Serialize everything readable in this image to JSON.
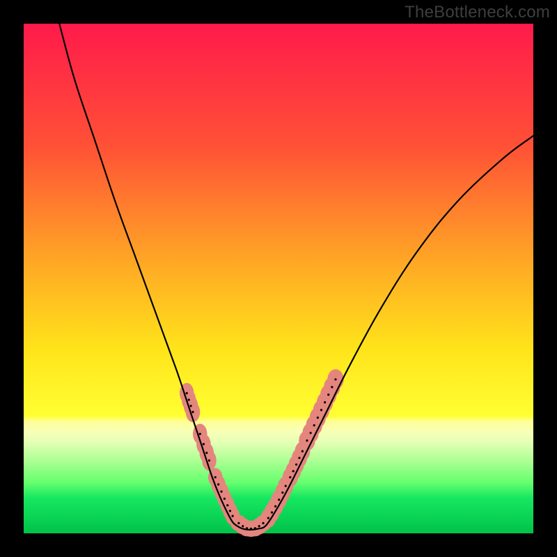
{
  "watermark": "TheBottleneck.com",
  "chart_data": {
    "type": "line",
    "title": "",
    "xlabel": "",
    "ylabel": "",
    "xlim": [
      0,
      100
    ],
    "ylim": [
      0,
      100
    ],
    "grid": false,
    "gradient_stops": [
      {
        "pos": 0,
        "color": "#ff1a4b"
      },
      {
        "pos": 24,
        "color": "#ff5136"
      },
      {
        "pos": 48,
        "color": "#ffac24"
      },
      {
        "pos": 64,
        "color": "#ffe41a"
      },
      {
        "pos": 77,
        "color": "#ffff33"
      },
      {
        "pos": 78,
        "color": "#ffff96"
      },
      {
        "pos": 80,
        "color": "#f8ffb8"
      },
      {
        "pos": 82,
        "color": "#e6ffb5"
      },
      {
        "pos": 85,
        "color": "#b8ff9a"
      },
      {
        "pos": 90,
        "color": "#66ff6e"
      },
      {
        "pos": 93,
        "color": "#17e860"
      },
      {
        "pos": 100,
        "color": "#00c24a"
      }
    ],
    "series": [
      {
        "name": "left-limb",
        "stroke": "#000000",
        "stroke_width": 2.2,
        "x": [
          7,
          10,
          14,
          18,
          22,
          26,
          30,
          32,
          34,
          35.5,
          37,
          38.5,
          40,
          41,
          41.8
        ],
        "y": [
          100,
          89,
          77,
          65,
          54,
          43,
          32,
          26,
          20,
          15.5,
          11,
          7.2,
          4,
          2.2,
          1.5
        ]
      },
      {
        "name": "valley-floor",
        "stroke": "#000000",
        "stroke_width": 2.2,
        "x": [
          41.8,
          43,
          44.5,
          46,
          47.5
        ],
        "y": [
          1.5,
          0.9,
          0.7,
          0.9,
          1.5
        ]
      },
      {
        "name": "right-limb",
        "stroke": "#000000",
        "stroke_width": 2.2,
        "x": [
          47.5,
          49.5,
          52,
          55,
          59,
          64,
          70,
          77,
          85,
          94,
          100
        ],
        "y": [
          1.5,
          4.5,
          9,
          15,
          23,
          33,
          44,
          55,
          65,
          73.5,
          78
        ]
      }
    ],
    "blob_clusters": [
      {
        "name": "left-upper",
        "color": "#e4857e",
        "points": [
          [
            32.0,
            27.5
          ],
          [
            32.4,
            26.2
          ],
          [
            32.8,
            25.0
          ],
          [
            33.2,
            23.8
          ]
        ],
        "rx": 1.4,
        "ry": 2.0
      },
      {
        "name": "left-mid",
        "color": "#e4857e",
        "points": [
          [
            34.6,
            19.5
          ],
          [
            35.3,
            17.5
          ],
          [
            35.9,
            15.8
          ],
          [
            36.4,
            14.3
          ]
        ],
        "rx": 1.4,
        "ry": 2.0
      },
      {
        "name": "left-lower",
        "color": "#e4857e",
        "points": [
          [
            37.6,
            11.0
          ],
          [
            38.2,
            9.6
          ],
          [
            38.8,
            8.2
          ],
          [
            39.4,
            6.8
          ],
          [
            40.0,
            5.5
          ],
          [
            40.5,
            4.4
          ],
          [
            41.0,
            3.4
          ]
        ],
        "rx": 1.4,
        "ry": 1.8
      },
      {
        "name": "valley",
        "color": "#e4857e",
        "points": [
          [
            42.2,
            2.0
          ],
          [
            43.0,
            1.4
          ],
          [
            43.8,
            1.0
          ],
          [
            44.6,
            0.9
          ],
          [
            45.4,
            1.0
          ],
          [
            46.2,
            1.4
          ],
          [
            47.0,
            2.0
          ]
        ],
        "rx": 1.6,
        "ry": 1.6
      },
      {
        "name": "right-lower",
        "color": "#e4857e",
        "points": [
          [
            48.0,
            3.0
          ],
          [
            48.7,
            4.1
          ],
          [
            49.4,
            5.3
          ],
          [
            50.1,
            6.6
          ],
          [
            50.8,
            8.0
          ],
          [
            51.4,
            9.3
          ]
        ],
        "rx": 1.5,
        "ry": 1.9
      },
      {
        "name": "right-mid",
        "color": "#e4857e",
        "points": [
          [
            52.3,
            11.0
          ],
          [
            52.9,
            12.2
          ],
          [
            53.5,
            13.5
          ],
          [
            54.1,
            14.8
          ],
          [
            54.7,
            16.1
          ]
        ],
        "rx": 1.5,
        "ry": 1.9
      },
      {
        "name": "right-upper",
        "color": "#e4857e",
        "points": [
          [
            55.6,
            18.2
          ],
          [
            56.3,
            19.7
          ],
          [
            57.0,
            21.2
          ],
          [
            57.7,
            22.7
          ],
          [
            58.4,
            24.2
          ],
          [
            59.1,
            25.7
          ],
          [
            59.8,
            27.2
          ],
          [
            60.5,
            28.7
          ],
          [
            61.2,
            30.2
          ]
        ],
        "rx": 1.6,
        "ry": 2.0
      }
    ]
  }
}
